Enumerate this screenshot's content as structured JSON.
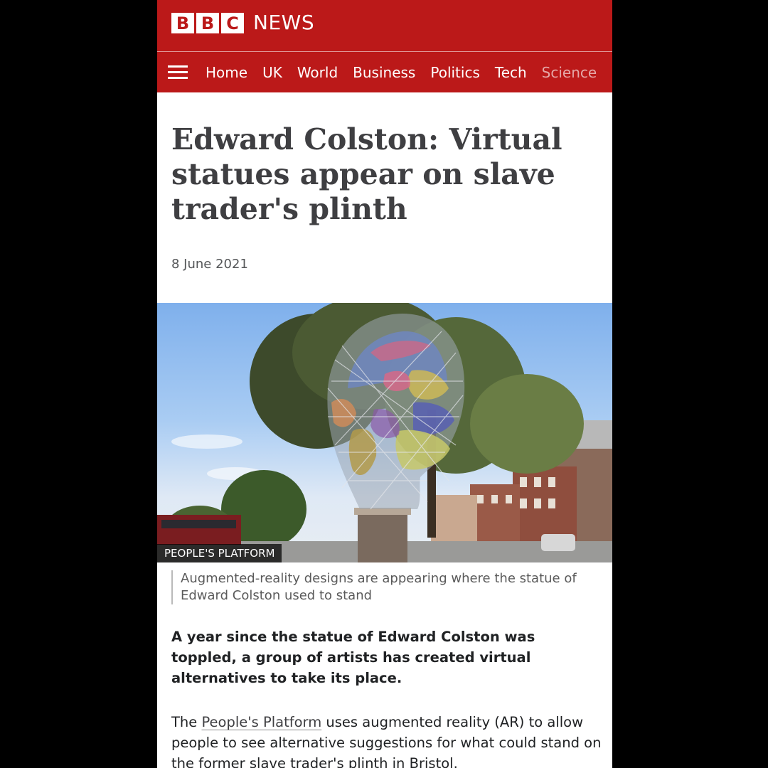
{
  "header": {
    "logo_letters": [
      "B",
      "B",
      "C"
    ],
    "logo_word": "NEWS"
  },
  "nav": {
    "items": [
      "Home",
      "UK",
      "World",
      "Business",
      "Politics",
      "Tech",
      "Science"
    ]
  },
  "article": {
    "headline": "Edward Colston: Virtual statues appear on slave trader's plinth",
    "date": "8 June 2021",
    "image_credit": "PEOPLE'S PLATFORM",
    "caption": "Augmented-reality designs are appearing where the statue of Edward Colston used to stand",
    "lead": "A year since the statue of Edward Colston was toppled, a group of artists has created virtual alternatives to take its place.",
    "body_prefix": "The ",
    "body_link": "People's Platform",
    "body_suffix": " uses augmented reality (AR) to allow people to see alternative suggestions for what could stand on the former slave trader's plinth in Bristol."
  },
  "colors": {
    "brand_red": "#bb1919",
    "headline_text": "#3f3f42"
  }
}
